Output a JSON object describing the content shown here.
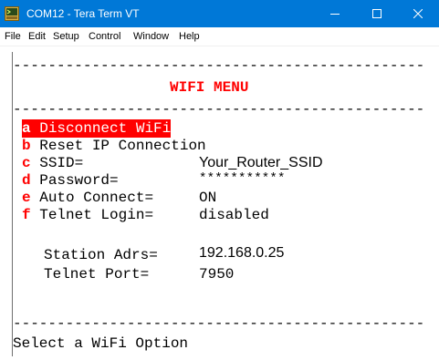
{
  "window": {
    "title": "COM12 - Tera Term VT",
    "icon": "tera-term-icon",
    "controls": [
      "minimize-icon",
      "maximize-icon",
      "close-icon"
    ],
    "titlebar_color": "#0078d7"
  },
  "menubar": {
    "items": [
      "File",
      "Edit",
      "Setup",
      "Control",
      "Window",
      "Help"
    ]
  },
  "terminal": {
    "separator": "-----------------------------------------------",
    "menu_title": "WIFI MENU",
    "options": [
      {
        "key": "a",
        "label": "Disconnect WiFi",
        "value": "",
        "selected": true
      },
      {
        "key": "b",
        "label": "Reset IP Connection",
        "value": "",
        "selected": false
      },
      {
        "key": "c",
        "label": "SSID=",
        "value": "Your_Router_SSID",
        "selected": false
      },
      {
        "key": "d",
        "label": "Password=",
        "value": "***********",
        "selected": false
      },
      {
        "key": "e",
        "label": "Auto Connect=",
        "value": "ON",
        "selected": false
      },
      {
        "key": "f",
        "label": "Telnet Login=",
        "value": "disabled",
        "selected": false
      }
    ],
    "info": [
      {
        "label": "Station Adrs=",
        "value": "192.168.0.25"
      },
      {
        "label": "Telnet Port=",
        "value": "7950"
      }
    ],
    "prompt": "Select a WiFi Option",
    "colors": {
      "key": "#ff0000",
      "title": "#ff0000",
      "highlight_bg": "#ff0000",
      "highlight_fg": "#ffffff"
    }
  }
}
